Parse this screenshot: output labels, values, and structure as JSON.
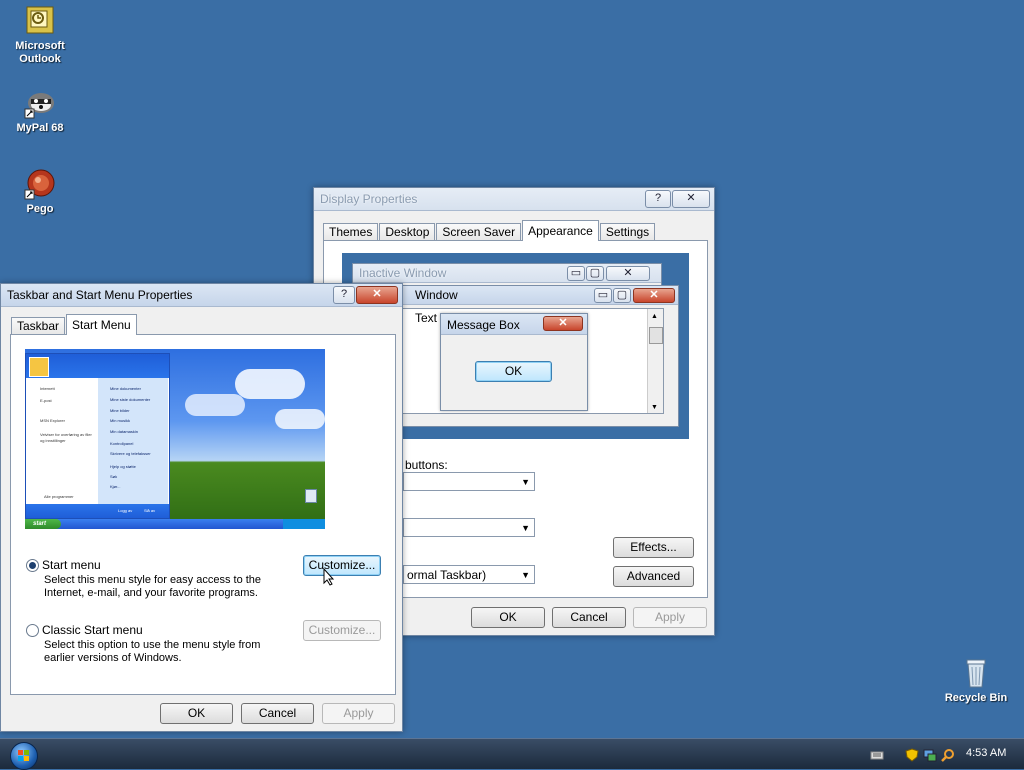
{
  "desktop": {
    "icons": [
      {
        "label_line1": "Microsoft",
        "label_line2": "Outlook",
        "icon": "outlook-icon"
      },
      {
        "label_line1": "MyPal 68",
        "icon": "mypal-icon"
      },
      {
        "label_line1": "Pego",
        "icon": "pego-icon"
      },
      {
        "label_line1": "Recycle Bin",
        "icon": "recycle-bin-icon"
      }
    ]
  },
  "display_properties": {
    "title": "Display Properties",
    "help": "?",
    "close": "✕",
    "tabs": [
      "Themes",
      "Desktop",
      "Screen Saver",
      "Appearance",
      "Settings"
    ],
    "preview": {
      "inactive_title": "Inactive Window",
      "active_title": "Window",
      "window_text": "Text",
      "message_box_title": "Message Box",
      "message_box_ok": "OK"
    },
    "buttons_label": "buttons:",
    "taskbar_combo": "ormal Taskbar)",
    "effects": "Effects...",
    "advanced": "Advanced",
    "ok": "OK",
    "cancel": "Cancel",
    "apply": "Apply"
  },
  "taskbar_properties": {
    "title": "Taskbar and Start Menu Properties",
    "help": "?",
    "close": "✕",
    "tabs": [
      "Taskbar",
      "Start Menu"
    ],
    "preview": {
      "start_label": "start",
      "menu_items_left": [
        "Internett",
        "E-post",
        "MSN Explorer",
        "Veiviser for overføring av filer og innstillinger"
      ],
      "menu_items_right": [
        "Mine dokumenter",
        "Mine siste dokumenter",
        "Mine bilder",
        "Min musikk",
        "Min datamaskin",
        "Kontrollpanel",
        "Skrivere og telefaksser",
        "Hjelp og støtte",
        "Søk",
        "Kjør..."
      ],
      "all_programs": "Alle programmer",
      "logoff": "Logg av",
      "shutdown": "Slå av"
    },
    "start_menu_label": "Start menu",
    "start_menu_desc1": "Select this menu style for easy access to the",
    "start_menu_desc2": "Internet, e-mail, and your favorite programs.",
    "customize1": "Customize...",
    "classic_label": "Classic Start menu",
    "classic_desc1": "Select this option to use the menu style from",
    "classic_desc2": "earlier versions of Windows.",
    "customize2": "Customize...",
    "ok": "OK",
    "cancel": "Cancel",
    "apply": "Apply"
  },
  "taskbar": {
    "clock": "4:53 AM"
  }
}
